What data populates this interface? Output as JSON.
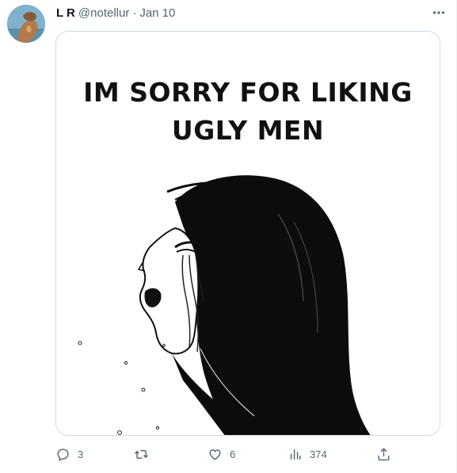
{
  "tweet": {
    "display_name": "L R",
    "handle": "@notellur",
    "separator": "·",
    "date": "Jan 10",
    "avatar_icon": "avatar-image",
    "more_icon": "more-horizontal-icon"
  },
  "media": {
    "meme_text_line_1": "IM SORRY FOR LIKING",
    "meme_text_line_2": "UGLY MEN",
    "image_description_icon": "crying-anime-girl-illustration"
  },
  "actions": {
    "reply": {
      "icon": "reply-icon",
      "count": "3"
    },
    "retweet": {
      "icon": "retweet-icon",
      "count": ""
    },
    "like": {
      "icon": "heart-icon",
      "count": "6"
    },
    "views": {
      "icon": "views-icon",
      "count": "374"
    },
    "share": {
      "icon": "share-icon",
      "count": ""
    }
  },
  "colors": {
    "text_primary": "#0f1419",
    "text_secondary": "#536471",
    "border": "#cfd9de"
  }
}
